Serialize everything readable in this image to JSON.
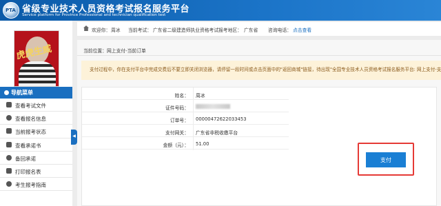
{
  "header": {
    "logo_text": "PTA",
    "title_cn": "省级专业技术人员资格考试报名服务平台",
    "title_en": "Service platform for Province Professional and technician qualification test"
  },
  "sidebar": {
    "avatar_art_text": "虎虎生威",
    "nav_title": "导航菜单",
    "items": [
      {
        "label": "查看考试文件"
      },
      {
        "label": "查看报名信息"
      },
      {
        "label": "当前报考状态"
      },
      {
        "label": "查看承诺书"
      },
      {
        "label": "备回承诺"
      },
      {
        "label": "打印报名表"
      },
      {
        "label": "考生报考指南"
      }
    ],
    "collapse_glyph": "◀"
  },
  "info_bar": {
    "welcome_label": "欢迎你：",
    "user_name": "周冰",
    "exam_label": "当前考试：",
    "exam_name": "广东省二级建造师执业资格考试",
    "region_label": "报考地区：",
    "region": "广东省",
    "phone_label": "咨询电话：",
    "phone_link": "点击查看"
  },
  "content": {
    "breadcrumb": "当前位置：网上支付-当前订单",
    "notice": "支付过程中，你在支付平台中完成交费后不要立即关闭浏览器，请停留一段时间或点击页面中的\"返回商城\"链接，待出现\"全国专业技术人员资格考试报名服务平台: 网上支付-支付",
    "rows": [
      {
        "label": "姓名：",
        "value": "周冰"
      },
      {
        "label": "证件号码：",
        "value": ""
      },
      {
        "label": "订单号：",
        "value": "00000472622033453"
      },
      {
        "label": "支付网关：",
        "value": "广东省非税收缴平台"
      },
      {
        "label": "金额（元）：",
        "value": "51.00"
      }
    ],
    "pay_button": "支付"
  }
}
